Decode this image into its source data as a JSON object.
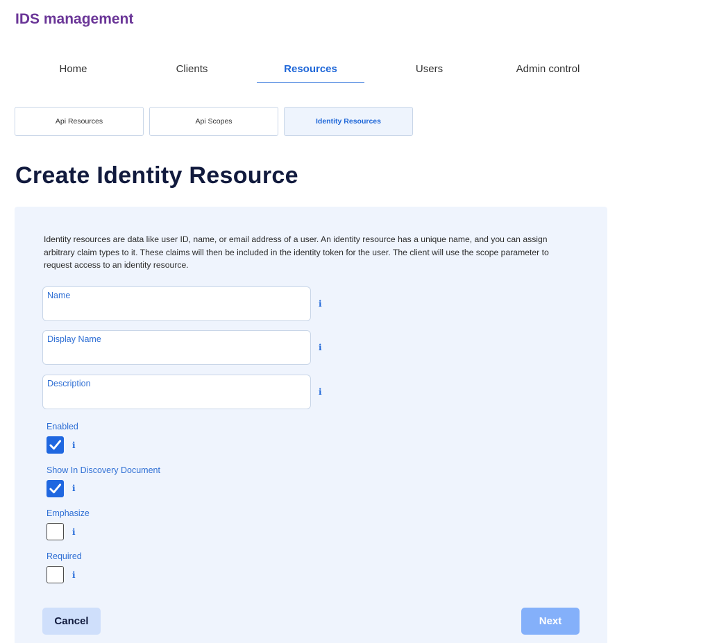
{
  "app": {
    "title": "IDS management"
  },
  "nav": {
    "items": [
      {
        "label": "Home",
        "active": false
      },
      {
        "label": "Clients",
        "active": false
      },
      {
        "label": "Resources",
        "active": true
      },
      {
        "label": "Users",
        "active": false
      },
      {
        "label": "Admin control",
        "active": false
      }
    ]
  },
  "subtabs": [
    {
      "label": "Api Resources",
      "active": false
    },
    {
      "label": "Api Scopes",
      "active": false
    },
    {
      "label": "Identity Resources",
      "active": true
    }
  ],
  "page": {
    "title": "Create Identity Resource"
  },
  "form": {
    "intro": "Identity resources are data like user ID, name, or email address of a user. An identity resource has a unique name, and you can assign arbitrary claim types to it. These claims will then be included in the identity token for the user. The client will use the scope parameter to request access to an identity resource.",
    "fields": [
      {
        "label": "Name",
        "value": ""
      },
      {
        "label": "Display Name",
        "value": ""
      },
      {
        "label": "Description",
        "value": ""
      }
    ],
    "checkboxes": [
      {
        "label": "Enabled",
        "checked": true
      },
      {
        "label": "Show In Discovery Document",
        "checked": true
      },
      {
        "label": "Emphasize",
        "checked": false
      },
      {
        "label": "Required",
        "checked": false
      }
    ],
    "info_glyph": "i",
    "cancel_label": "Cancel",
    "next_label": "Next"
  },
  "colors": {
    "brand": "#6a3597",
    "accent": "#1f67d8",
    "panel_bg": "#eff4fd",
    "checkbox_checked": "#1f67e0",
    "next_button": "#84b0fa",
    "cancel_button": "#cfdffb"
  },
  "icons": {
    "info": "info-icon",
    "check": "checkmark-icon"
  }
}
